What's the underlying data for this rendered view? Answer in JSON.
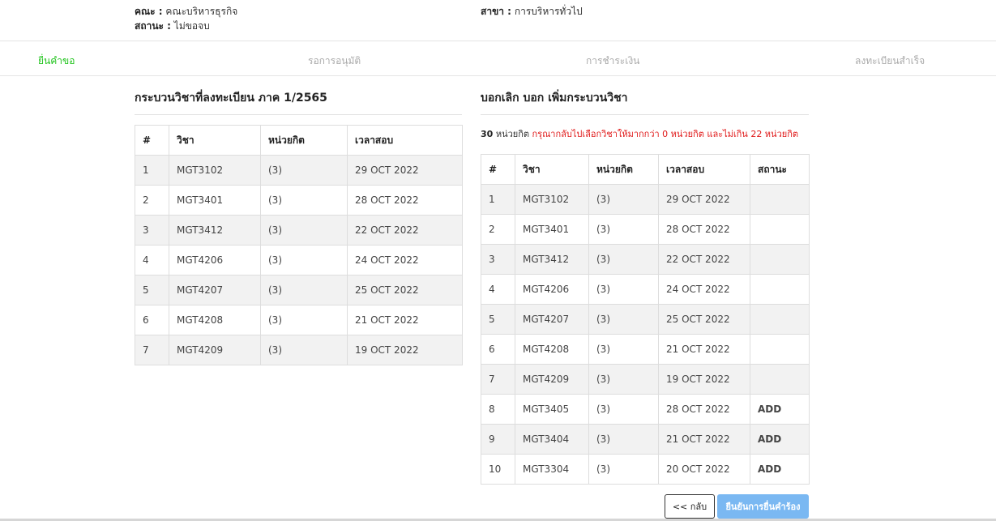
{
  "header": {
    "faculty_label": "คณะ :",
    "faculty_value": "คณะบริหารธุรกิจ",
    "status_label": "สถานะ :",
    "status_value": "ไม่ขอจบ",
    "major_label": "สาขา :",
    "major_value": "การบริหารทั่วไป"
  },
  "steps": [
    {
      "label": "ยื่นคำขอ",
      "active": true
    },
    {
      "label": "รอการอนุมัติ",
      "active": false
    },
    {
      "label": "การชำระเงิน",
      "active": false
    },
    {
      "label": "ลงทะเบียนสำเร็จ",
      "active": false
    }
  ],
  "registered": {
    "title": "กระบวนวิชาที่ลงทะเบียน ภาค 1/2565",
    "columns": [
      "#",
      "วิชา",
      "หน่วยกิต",
      "เวลาสอบ"
    ],
    "rows": [
      [
        "1",
        "MGT3102",
        "(3)",
        "29 OCT 2022"
      ],
      [
        "2",
        "MGT3401",
        "(3)",
        "28 OCT 2022"
      ],
      [
        "3",
        "MGT3412",
        "(3)",
        "22 OCT 2022"
      ],
      [
        "4",
        "MGT4206",
        "(3)",
        "24 OCT 2022"
      ],
      [
        "5",
        "MGT4207",
        "(3)",
        "25 OCT 2022"
      ],
      [
        "6",
        "MGT4208",
        "(3)",
        "21 OCT 2022"
      ],
      [
        "7",
        "MGT4209",
        "(3)",
        "19 OCT 2022"
      ]
    ]
  },
  "changes": {
    "title": "บอกเลิก บอก เพิ่มกระบวนวิชา",
    "credits_value": "30",
    "credits_unit": "หน่วยกิต",
    "credits_warning": "กรุณากลับไปเลือกวิชาให้มากกว่า 0 หน่วยกิต และไม่เกิน 22 หน่วยกิต",
    "columns": [
      "#",
      "วิชา",
      "หน่วยกิต",
      "เวลาสอบ",
      "สถานะ"
    ],
    "rows": [
      [
        "1",
        "MGT3102",
        "(3)",
        "29 OCT 2022",
        ""
      ],
      [
        "2",
        "MGT3401",
        "(3)",
        "28 OCT 2022",
        ""
      ],
      [
        "3",
        "MGT3412",
        "(3)",
        "22 OCT 2022",
        ""
      ],
      [
        "4",
        "MGT4206",
        "(3)",
        "24 OCT 2022",
        ""
      ],
      [
        "5",
        "MGT4207",
        "(3)",
        "25 OCT 2022",
        ""
      ],
      [
        "6",
        "MGT4208",
        "(3)",
        "21 OCT 2022",
        ""
      ],
      [
        "7",
        "MGT4209",
        "(3)",
        "19 OCT 2022",
        ""
      ],
      [
        "8",
        "MGT3405",
        "(3)",
        "28 OCT 2022",
        "ADD"
      ],
      [
        "9",
        "MGT3404",
        "(3)",
        "21 OCT 2022",
        "ADD"
      ],
      [
        "10",
        "MGT3304",
        "(3)",
        "20 OCT 2022",
        "ADD"
      ]
    ]
  },
  "buttons": {
    "back_label": "<< กลับ",
    "confirm_label": "ยืนยันการยื่นคำร้อง"
  },
  "colors": {
    "active_step": "#22c41e",
    "warning": "#e01919",
    "confirm_button": "#7ab8f2"
  }
}
